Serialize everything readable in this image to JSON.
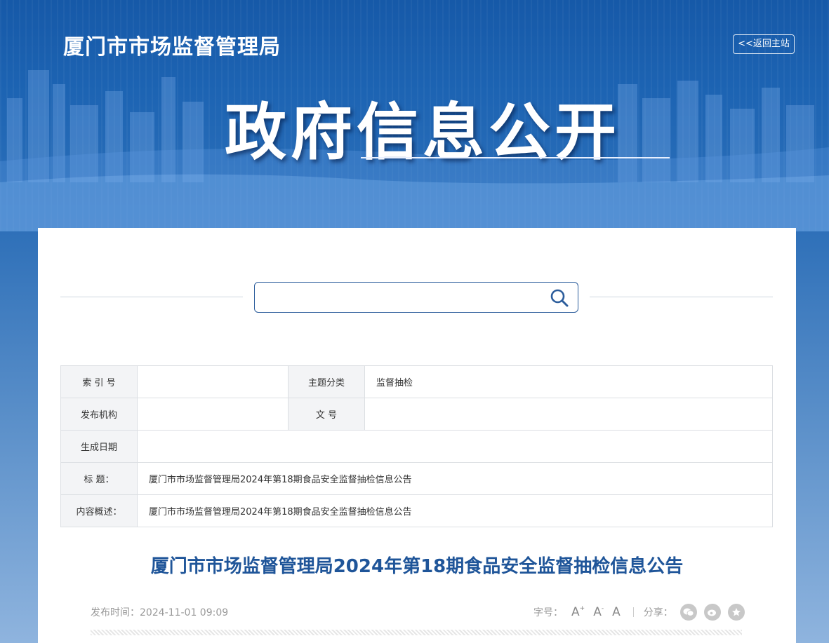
{
  "header": {
    "site_title": "厦门市市场监督管理局",
    "back_label": "<<返回主站",
    "banner_title": "政府信息公开"
  },
  "search": {
    "placeholder": ""
  },
  "meta": {
    "index_label": "索 引 号",
    "index_value": "",
    "topic_label": "主题分类",
    "topic_value": "监督抽检",
    "publisher_label": "发布机构",
    "publisher_value": "",
    "docno_label": "文  号",
    "docno_value": "",
    "date_label": "生成日期",
    "date_value": "",
    "title_label": "标  题：",
    "title_value": "厦门市市场监督管理局2024年第18期食品安全监督抽检信息公告",
    "summary_label": "内容概述：",
    "summary_value": "厦门市市场监督管理局2024年第18期食品安全监督抽检信息公告"
  },
  "article": {
    "title": "厦门市市场监督管理局2024年第18期食品安全监督抽检信息公告",
    "publish_time": "发布时间：2024-11-01 09:09"
  },
  "tools": {
    "font_label": "字号：",
    "font_large": "A",
    "font_large_sup": "+",
    "font_small": "A",
    "font_small_sup": "-",
    "font_default": "A",
    "share_label": "分享："
  },
  "icons": [
    "search-icon",
    "wechat-icon",
    "weibo-icon",
    "favorite-icon"
  ],
  "colors": {
    "brand_blue": "#1f5599",
    "banner_blue": "#1659a8"
  }
}
